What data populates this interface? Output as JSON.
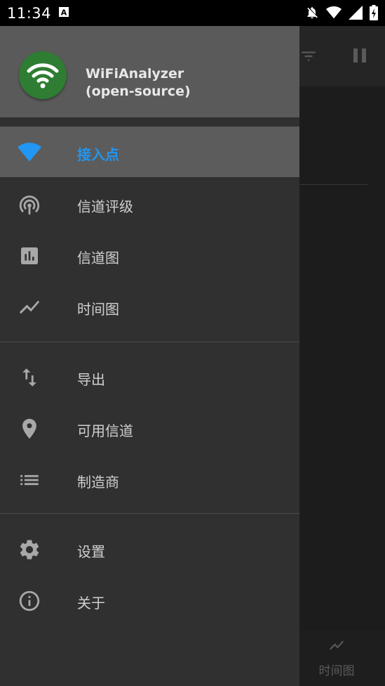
{
  "status_bar": {
    "time": "11:34",
    "icons": [
      "a-notification-icon",
      "notifications-off-icon",
      "wifi-icon",
      "signal-icon",
      "battery-charging-icon"
    ]
  },
  "background_app": {
    "toolbar_icons": [
      "filter-icon",
      "pause-icon"
    ],
    "bottom_tab_label": "时间图"
  },
  "drawer": {
    "app_name": "WiFiAnalyzer\n(open-source)",
    "accent_color": "#2196f3",
    "logo_color": "#2e7d32",
    "groups": [
      [
        {
          "label": "接入点",
          "icon": "wifi-icon",
          "active": true
        },
        {
          "label": "信道评级",
          "icon": "wifi-tethering-icon",
          "active": false
        },
        {
          "label": "信道图",
          "icon": "bar-chart-icon",
          "active": false
        },
        {
          "label": "时间图",
          "icon": "line-chart-icon",
          "active": false
        }
      ],
      [
        {
          "label": "导出",
          "icon": "import-export-icon",
          "active": false
        },
        {
          "label": "可用信道",
          "icon": "location-pin-icon",
          "active": false
        },
        {
          "label": "制造商",
          "icon": "list-icon",
          "active": false
        }
      ],
      [
        {
          "label": "设置",
          "icon": "settings-icon",
          "active": false
        },
        {
          "label": "关于",
          "icon": "info-icon",
          "active": false
        }
      ]
    ]
  }
}
